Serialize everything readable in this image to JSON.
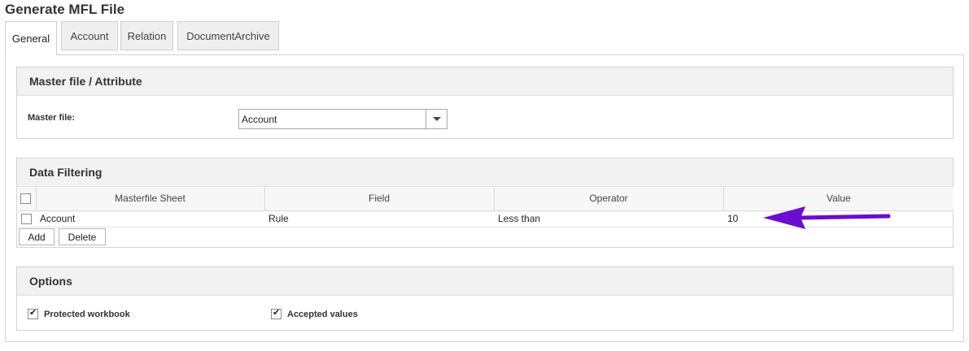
{
  "page": {
    "title": "Generate MFL File"
  },
  "tabs": [
    {
      "label": "General",
      "active": true
    },
    {
      "label": "Account",
      "active": false
    },
    {
      "label": "Relation",
      "active": false
    },
    {
      "label": "DocumentArchive",
      "active": false
    }
  ],
  "master_section": {
    "title": "Master file / Attribute",
    "master_file_label": "Master file:",
    "master_file_value": "Account"
  },
  "filtering_section": {
    "title": "Data Filtering",
    "columns": [
      "Masterfile Sheet",
      "Field",
      "Operator",
      "Value"
    ],
    "rows": [
      {
        "sheet": "Account",
        "field": "Rule",
        "operator": "Less than",
        "value": "10",
        "checked": false
      }
    ],
    "add_label": "Add",
    "delete_label": "Delete"
  },
  "options_section": {
    "title": "Options",
    "protected_workbook_label": "Protected workbook",
    "protected_workbook_checked": true,
    "accepted_values_label": "Accepted values",
    "accepted_values_checked": true
  },
  "annotation": {
    "arrow_color": "#6a0dcf",
    "arrow_icon": "arrow-left-icon"
  }
}
